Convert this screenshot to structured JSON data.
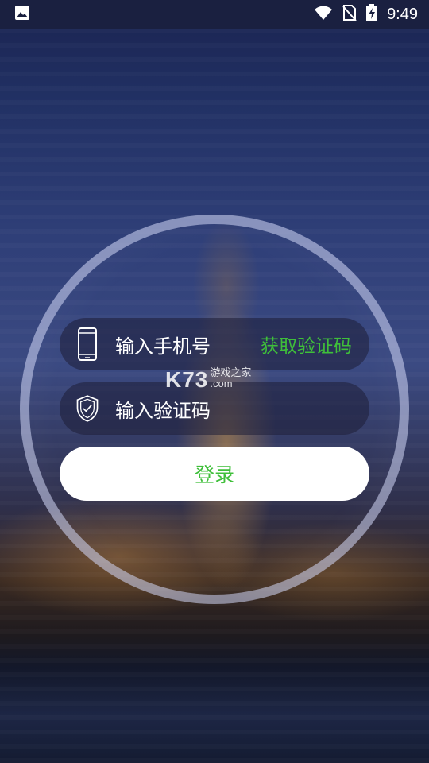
{
  "status_bar": {
    "time": "9:49",
    "left_icon": "image-icon",
    "right_icons": [
      "wifi-icon",
      "no-sim-icon",
      "battery-charging-icon"
    ]
  },
  "login": {
    "phone_placeholder": "输入手机号",
    "get_code_label": "获取验证码",
    "code_placeholder": "输入验证码",
    "submit_label": "登录"
  },
  "watermark": {
    "logo": "K73",
    "tagline": "游戏之家",
    "domain": ".com"
  },
  "colors": {
    "accent_green": "#3fbf3a",
    "button_bg": "#ffffff"
  }
}
